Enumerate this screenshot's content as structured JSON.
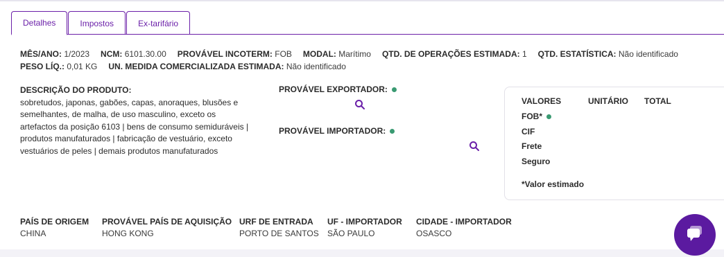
{
  "tabs": [
    {
      "label": "Detalhes",
      "active": true
    },
    {
      "label": "Impostos",
      "active": false
    },
    {
      "label": "Ex-tarifário",
      "active": false
    }
  ],
  "summary": {
    "mes_ano_label": "MÊS/ANO:",
    "mes_ano": "1/2023",
    "ncm_label": "NCM:",
    "ncm": "6101.30.00",
    "incoterm_label": "PROVÁVEL INCOTERM:",
    "incoterm": "FOB",
    "modal_label": "MODAL:",
    "modal": "Marítimo",
    "qtd_op_label": "QTD. DE OPERAÇÕES ESTIMADA:",
    "qtd_op": "1",
    "qtd_est_label": "QTD. ESTATÍSTICA:",
    "qtd_est": "Não identificado",
    "peso_label": "PESO LÍQ.:",
    "peso": "0,01 KG",
    "un_medida_label": "UN. MEDIDA COMERCIALIZADA ESTIMADA:",
    "un_medida": "Não identificado"
  },
  "description": {
    "label": "DESCRIÇÃO DO PRODUTO:",
    "text": "sobretudos, japonas, gabões, capas, anoraques, blusões e semelhantes, de malha, de uso masculino, exceto os artefactos da posição 6103 | bens de consumo semiduráveis | produtos manufaturados | fabricação de vestuário, exceto vestuários de peles | demais produtos manufaturados"
  },
  "parties": {
    "exporter_label": "PROVÁVEL EXPORTADOR:",
    "importer_label": "PROVÁVEL IMPORTADOR:",
    "status_color": "#3a9a72"
  },
  "values_card": {
    "col_valores": "VALORES",
    "col_unitario": "UNITÁRIO",
    "col_total": "TOTAL",
    "fob": "FOB*",
    "cif": "CIF",
    "frete": "Frete",
    "seguro": "Seguro",
    "note": "*Valor estimado"
  },
  "fields": {
    "pais_origem_label": "PAÍS DE ORIGEM",
    "pais_origem": "CHINA",
    "pais_aquisicao_label": "PROVÁVEL PAÍS DE AQUISIÇÃO",
    "pais_aquisicao": "HONG KONG",
    "urf_label": "URF DE ENTRADA",
    "urf": "PORTO DE SANTOS",
    "uf_label": "UF - IMPORTADOR",
    "uf": "SÃO PAULO",
    "cidade_label": "CIDADE - IMPORTADOR",
    "cidade": "OSASCO"
  },
  "theme": {
    "accent": "#6a1fa8",
    "chat_bg": "#5b1aa0"
  },
  "icons": {
    "search": "search-icon",
    "chat": "chat-icon"
  }
}
